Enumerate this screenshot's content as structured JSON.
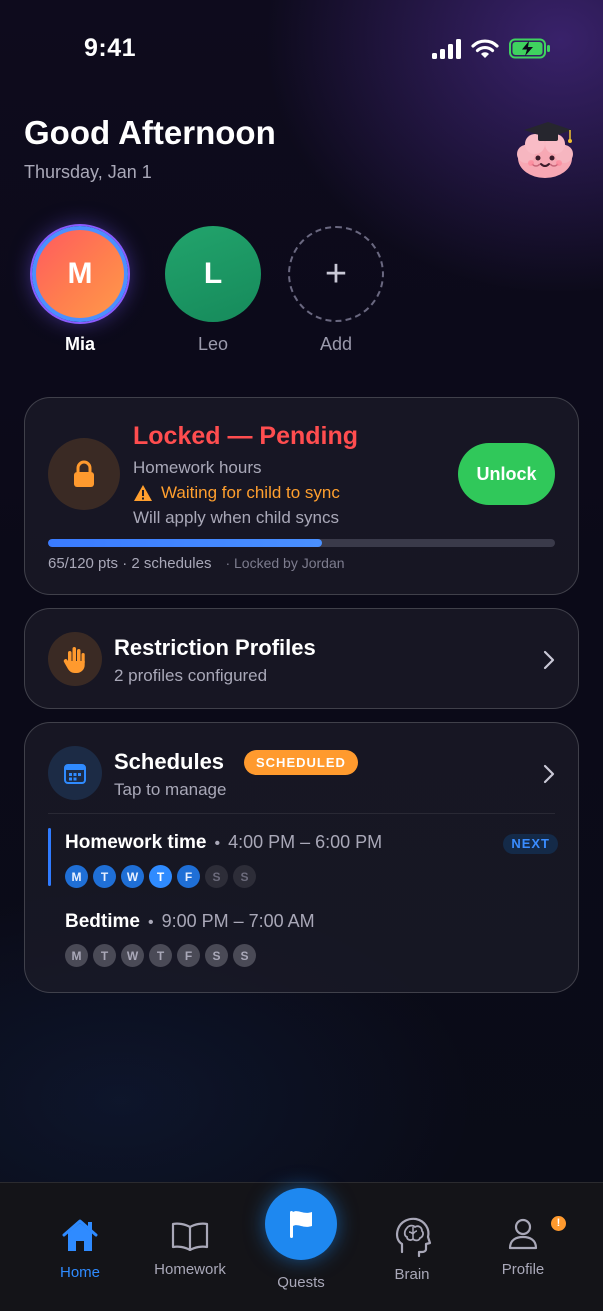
{
  "status_bar": {
    "time": "9:41"
  },
  "header": {
    "greeting": "Good Afternoon",
    "date": "Thursday, Jan 1"
  },
  "children": [
    {
      "initial": "M",
      "name": "Mia"
    },
    {
      "initial": "L",
      "name": "Leo"
    },
    {
      "initial": "+",
      "name": "Add"
    }
  ],
  "lock_card": {
    "title": "Locked — Pending",
    "subtitle": "Homework hours",
    "warning": "Waiting for child to sync",
    "apply_note": "Will apply when child syncs",
    "unlock_label": "Unlock",
    "progress_fraction": 0.54,
    "meta": "65/120 pts · 2 schedules",
    "locked_by": "· Locked by Jordan",
    "colors": {
      "title": "#ff4d4f",
      "warning": "#ff9f2e",
      "unlock": "#30c85a",
      "progress": "#3a7bff"
    }
  },
  "restriction_card": {
    "title": "Restriction Profiles",
    "subtitle": "2 profiles configured"
  },
  "schedules_card": {
    "title": "Schedules",
    "badge": "SCHEDULED",
    "subtitle": "Tap to manage",
    "items": [
      {
        "name": "Homework time",
        "separator": "•",
        "time": "4:00 PM – 6:00 PM",
        "badge": "NEXT",
        "days": [
          "M",
          "T",
          "W",
          "T",
          "F",
          "S",
          "S"
        ]
      },
      {
        "name": "Bedtime",
        "separator": "•",
        "time": "9:00 PM – 7:00 AM",
        "days": [
          "M",
          "T",
          "W",
          "T",
          "F",
          "S",
          "S"
        ]
      }
    ]
  },
  "nav": {
    "home": "Home",
    "homework": "Homework",
    "quests": "Quests",
    "brain": "Brain",
    "profile": "Profile",
    "profile_badge": "!",
    "active_color": "#2f8bff"
  },
  "icons": [
    "lock-icon",
    "warning-icon",
    "hand-icon",
    "calendar-icon",
    "chevron-right-icon",
    "home-icon",
    "book-icon",
    "flag-icon",
    "brain-icon",
    "person-icon",
    "mascot-brain-icon"
  ]
}
